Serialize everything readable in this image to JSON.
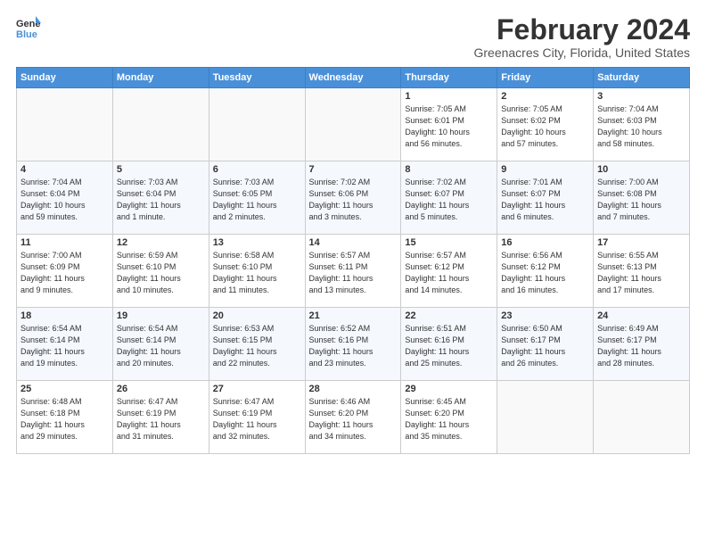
{
  "logo": {
    "line1": "General",
    "line2": "Blue"
  },
  "title": "February 2024",
  "location": "Greenacres City, Florida, United States",
  "days_of_week": [
    "Sunday",
    "Monday",
    "Tuesday",
    "Wednesday",
    "Thursday",
    "Friday",
    "Saturday"
  ],
  "weeks": [
    [
      {
        "num": "",
        "info": ""
      },
      {
        "num": "",
        "info": ""
      },
      {
        "num": "",
        "info": ""
      },
      {
        "num": "",
        "info": ""
      },
      {
        "num": "1",
        "info": "Sunrise: 7:05 AM\nSunset: 6:01 PM\nDaylight: 10 hours\nand 56 minutes."
      },
      {
        "num": "2",
        "info": "Sunrise: 7:05 AM\nSunset: 6:02 PM\nDaylight: 10 hours\nand 57 minutes."
      },
      {
        "num": "3",
        "info": "Sunrise: 7:04 AM\nSunset: 6:03 PM\nDaylight: 10 hours\nand 58 minutes."
      }
    ],
    [
      {
        "num": "4",
        "info": "Sunrise: 7:04 AM\nSunset: 6:04 PM\nDaylight: 10 hours\nand 59 minutes."
      },
      {
        "num": "5",
        "info": "Sunrise: 7:03 AM\nSunset: 6:04 PM\nDaylight: 11 hours\nand 1 minute."
      },
      {
        "num": "6",
        "info": "Sunrise: 7:03 AM\nSunset: 6:05 PM\nDaylight: 11 hours\nand 2 minutes."
      },
      {
        "num": "7",
        "info": "Sunrise: 7:02 AM\nSunset: 6:06 PM\nDaylight: 11 hours\nand 3 minutes."
      },
      {
        "num": "8",
        "info": "Sunrise: 7:02 AM\nSunset: 6:07 PM\nDaylight: 11 hours\nand 5 minutes."
      },
      {
        "num": "9",
        "info": "Sunrise: 7:01 AM\nSunset: 6:07 PM\nDaylight: 11 hours\nand 6 minutes."
      },
      {
        "num": "10",
        "info": "Sunrise: 7:00 AM\nSunset: 6:08 PM\nDaylight: 11 hours\nand 7 minutes."
      }
    ],
    [
      {
        "num": "11",
        "info": "Sunrise: 7:00 AM\nSunset: 6:09 PM\nDaylight: 11 hours\nand 9 minutes."
      },
      {
        "num": "12",
        "info": "Sunrise: 6:59 AM\nSunset: 6:10 PM\nDaylight: 11 hours\nand 10 minutes."
      },
      {
        "num": "13",
        "info": "Sunrise: 6:58 AM\nSunset: 6:10 PM\nDaylight: 11 hours\nand 11 minutes."
      },
      {
        "num": "14",
        "info": "Sunrise: 6:57 AM\nSunset: 6:11 PM\nDaylight: 11 hours\nand 13 minutes."
      },
      {
        "num": "15",
        "info": "Sunrise: 6:57 AM\nSunset: 6:12 PM\nDaylight: 11 hours\nand 14 minutes."
      },
      {
        "num": "16",
        "info": "Sunrise: 6:56 AM\nSunset: 6:12 PM\nDaylight: 11 hours\nand 16 minutes."
      },
      {
        "num": "17",
        "info": "Sunrise: 6:55 AM\nSunset: 6:13 PM\nDaylight: 11 hours\nand 17 minutes."
      }
    ],
    [
      {
        "num": "18",
        "info": "Sunrise: 6:54 AM\nSunset: 6:14 PM\nDaylight: 11 hours\nand 19 minutes."
      },
      {
        "num": "19",
        "info": "Sunrise: 6:54 AM\nSunset: 6:14 PM\nDaylight: 11 hours\nand 20 minutes."
      },
      {
        "num": "20",
        "info": "Sunrise: 6:53 AM\nSunset: 6:15 PM\nDaylight: 11 hours\nand 22 minutes."
      },
      {
        "num": "21",
        "info": "Sunrise: 6:52 AM\nSunset: 6:16 PM\nDaylight: 11 hours\nand 23 minutes."
      },
      {
        "num": "22",
        "info": "Sunrise: 6:51 AM\nSunset: 6:16 PM\nDaylight: 11 hours\nand 25 minutes."
      },
      {
        "num": "23",
        "info": "Sunrise: 6:50 AM\nSunset: 6:17 PM\nDaylight: 11 hours\nand 26 minutes."
      },
      {
        "num": "24",
        "info": "Sunrise: 6:49 AM\nSunset: 6:17 PM\nDaylight: 11 hours\nand 28 minutes."
      }
    ],
    [
      {
        "num": "25",
        "info": "Sunrise: 6:48 AM\nSunset: 6:18 PM\nDaylight: 11 hours\nand 29 minutes."
      },
      {
        "num": "26",
        "info": "Sunrise: 6:47 AM\nSunset: 6:19 PM\nDaylight: 11 hours\nand 31 minutes."
      },
      {
        "num": "27",
        "info": "Sunrise: 6:47 AM\nSunset: 6:19 PM\nDaylight: 11 hours\nand 32 minutes."
      },
      {
        "num": "28",
        "info": "Sunrise: 6:46 AM\nSunset: 6:20 PM\nDaylight: 11 hours\nand 34 minutes."
      },
      {
        "num": "29",
        "info": "Sunrise: 6:45 AM\nSunset: 6:20 PM\nDaylight: 11 hours\nand 35 minutes."
      },
      {
        "num": "",
        "info": ""
      },
      {
        "num": "",
        "info": ""
      }
    ]
  ]
}
